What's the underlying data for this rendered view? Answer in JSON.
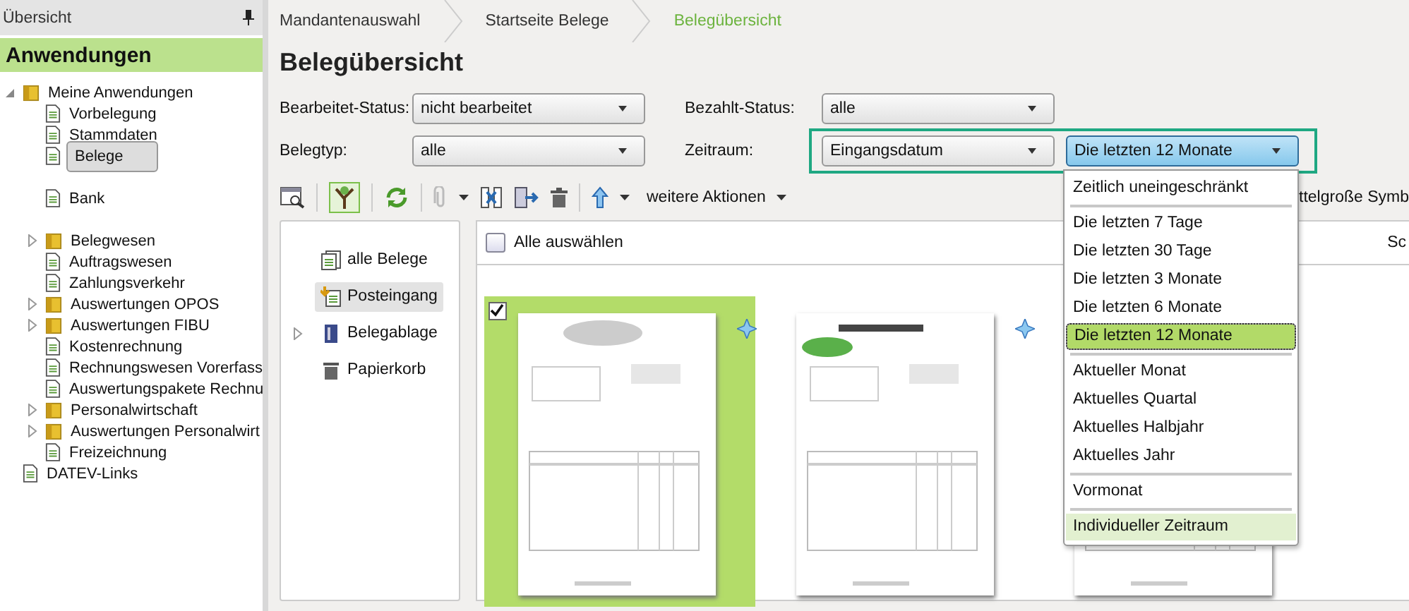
{
  "sidebar": {
    "header": "Übersicht",
    "title": "Anwendungen",
    "tree": [
      {
        "label": "Meine Anwendungen",
        "kind": "folder",
        "expanded": true,
        "selected": false,
        "children": [
          {
            "label": "Vorbelegung",
            "kind": "doc",
            "selected": false
          },
          {
            "label": "Stammdaten",
            "kind": "doc",
            "selected": false
          },
          {
            "label": "Belege",
            "kind": "doc",
            "selected": true
          },
          {
            "label": "Bank",
            "kind": "doc",
            "selected": false
          },
          {
            "label": "Belegwesen",
            "kind": "folder",
            "expanded": false,
            "selected": false
          },
          {
            "label": "Auftragswesen",
            "kind": "doc",
            "selected": false
          },
          {
            "label": "Zahlungsverkehr",
            "kind": "doc",
            "selected": false
          },
          {
            "label": "Auswertungen OPOS",
            "kind": "folder",
            "expanded": false,
            "selected": false
          },
          {
            "label": "Auswertungen FIBU",
            "kind": "folder",
            "expanded": false,
            "selected": false
          },
          {
            "label": "Kostenrechnung",
            "kind": "doc",
            "selected": false
          },
          {
            "label": "Rechnungswesen Vorerfass",
            "kind": "doc",
            "selected": false
          },
          {
            "label": "Auswertungspakete Rechnu",
            "kind": "doc",
            "selected": false
          },
          {
            "label": "Personalwirtschaft",
            "kind": "folder",
            "expanded": false,
            "selected": false
          },
          {
            "label": "Auswertungen Personalwirt",
            "kind": "folder",
            "expanded": false,
            "selected": false
          },
          {
            "label": "Freizeichnung",
            "kind": "doc",
            "selected": false
          }
        ]
      },
      {
        "label": "DATEV-Links",
        "kind": "doc",
        "selected": false
      }
    ]
  },
  "breadcrumb": [
    {
      "label": "Mandantenauswahl",
      "selected": false
    },
    {
      "label": "Startseite Belege",
      "selected": false
    },
    {
      "label": "Belegübersicht",
      "selected": true
    }
  ],
  "title": "Belegübersicht",
  "filters": {
    "bearbeitet_label": "Bearbeitet-Status:",
    "bearbeitet_value": "nicht bearbeitet",
    "bezahlt_label": "Bezahlt-Status:",
    "bezahlt_value": "alle",
    "belegtyp_label": "Belegtyp:",
    "belegtyp_value": "alle",
    "zeitraum_label": "Zeitraum:",
    "zeitraum_field": "Eingangsdatum",
    "zeitraum_value": "Die letzten 12 Monate"
  },
  "toolbar": {
    "more_actions": "weitere Aktionen",
    "view_size": "ttelgroße Symb"
  },
  "folders": [
    {
      "label": "alle Belege",
      "selected": false
    },
    {
      "label": "Posteingang",
      "selected": true
    },
    {
      "label": "Belegablage",
      "expanded": false,
      "selected": false
    },
    {
      "label": "Papierkorb",
      "selected": false
    }
  ],
  "grid": {
    "select_all": "Alle auswählen",
    "select_all_checked": false,
    "sort": "Sc"
  },
  "documents": [
    {
      "selected": true,
      "checked": true,
      "pinned": true
    },
    {
      "selected": false,
      "pinned": true
    },
    {
      "selected": false
    }
  ],
  "dropdown": [
    {
      "kind": "item",
      "label": "Zeitlich uneingeschränkt",
      "selected": false,
      "hovered": false
    },
    {
      "kind": "separator"
    },
    {
      "kind": "item",
      "label": "Die letzten 7 Tage",
      "selected": false,
      "hovered": false
    },
    {
      "kind": "item",
      "label": "Die letzten 30 Tage",
      "selected": false,
      "hovered": false
    },
    {
      "kind": "item",
      "label": "Die letzten 3 Monate",
      "selected": false,
      "hovered": false
    },
    {
      "kind": "item",
      "label": "Die letzten 6 Monate",
      "selected": false,
      "hovered": false
    },
    {
      "kind": "item",
      "label": "Die letzten 12 Monate",
      "selected": true,
      "hovered": false
    },
    {
      "kind": "separator"
    },
    {
      "kind": "item",
      "label": "Aktueller Monat",
      "selected": false,
      "hovered": false
    },
    {
      "kind": "item",
      "label": "Aktuelles Quartal",
      "selected": false,
      "hovered": false
    },
    {
      "kind": "item",
      "label": "Aktuelles Halbjahr",
      "selected": false,
      "hovered": false
    },
    {
      "kind": "item",
      "label": "Aktuelles Jahr",
      "selected": false,
      "hovered": false
    },
    {
      "kind": "separator"
    },
    {
      "kind": "item",
      "label": "Vormonat",
      "selected": false,
      "hovered": false
    },
    {
      "kind": "separator"
    },
    {
      "kind": "item",
      "label": "Individueller Zeitraum",
      "selected": false,
      "hovered": true
    }
  ]
}
